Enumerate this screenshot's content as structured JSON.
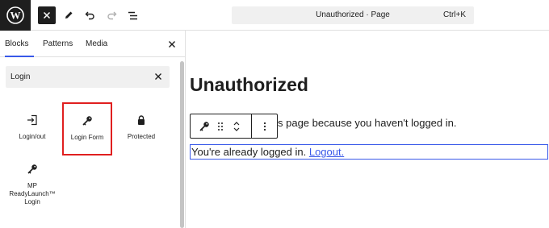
{
  "topbar": {
    "logo_icon": "wordpress-logo-icon",
    "close_icon": "close-icon",
    "edit_icon": "pencil-icon",
    "undo_icon": "undo-icon",
    "redo_icon": "redo-icon",
    "document_overview_icon": "list-view-icon",
    "command_bar": {
      "title": "Unauthorized · Page",
      "shortcut": "Ctrl+K"
    }
  },
  "sidebar": {
    "tabs": [
      {
        "label": "Blocks",
        "active": true
      },
      {
        "label": "Patterns",
        "active": false
      },
      {
        "label": "Media",
        "active": false
      }
    ],
    "search": {
      "value": "Login",
      "clear_icon": "close-icon"
    },
    "blocks": [
      {
        "label": "Login/out",
        "icon": "login-icon"
      },
      {
        "label": "Login Form",
        "icon": "key-icon",
        "highlighted": true
      },
      {
        "label": "Protected",
        "icon": "lock-icon"
      },
      {
        "label": "MP ReadyLaunch™ Login",
        "icon": "key-icon"
      }
    ],
    "highlight_color": "#e01f1f"
  },
  "canvas": {
    "title": "Unauthorized",
    "paragraph1": "s page because you haven't logged in.",
    "paragraph2_text": "You're already logged in. ",
    "paragraph2_link": "Logout.",
    "accent_color": "#3858e9"
  },
  "block_toolbar": {
    "block_icon": "key-icon",
    "drag_icon": "drag-handle-icon",
    "move_up_icon": "chevron-up-icon",
    "move_down_icon": "chevron-down-icon",
    "options_icon": "more-vertical-icon"
  }
}
